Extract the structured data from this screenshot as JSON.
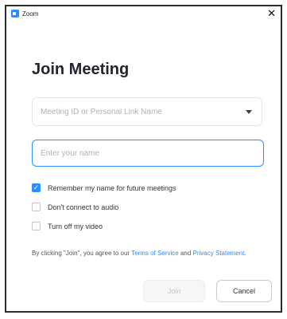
{
  "window": {
    "title": "Zoom",
    "close_glyph": "✕",
    "app_icon": "zoom-logo"
  },
  "heading": "Join Meeting",
  "meeting_id": {
    "placeholder": "Meeting ID or Personal Link Name",
    "icon": "chevron-down"
  },
  "name_field": {
    "value": "",
    "placeholder": "Enter your name"
  },
  "options": [
    {
      "label": "Remember my name for future meetings",
      "checked": true
    },
    {
      "label": "Don't connect to audio",
      "checked": false
    },
    {
      "label": "Turn off my video",
      "checked": false
    }
  ],
  "terms": {
    "prefix": "By clicking \"Join\", you agree to our ",
    "terms_link": "Terms of Service",
    "middle": " and ",
    "privacy_link": "Privacy Statement",
    "suffix": "."
  },
  "buttons": {
    "join": "Join",
    "cancel": "Cancel"
  },
  "colors": {
    "accent": "#2d8cff",
    "heading": "#232333"
  }
}
